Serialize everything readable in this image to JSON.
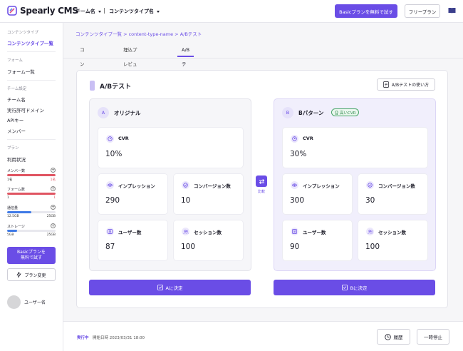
{
  "header": {
    "logo_text": "Spearly CMS",
    "team_select": "チーム名",
    "separator": "|",
    "content_type_select": "コンテンツタイプ名",
    "trial_button": "Basicプランを無料で試す",
    "plan_button": "フリープラン",
    "book_icon": "book-icon"
  },
  "sidebar": {
    "sections": {
      "content_type": "コンテンツタイプ",
      "form": "フォーム",
      "team": "チーム設定",
      "plan": "プラン"
    },
    "items": {
      "content_type_list": "コンテンツタイプ一覧",
      "form_list": "フォーム一覧",
      "team_name": "チーム名",
      "allowed_domains": "実行許可ドメイン",
      "api_key": "APIキー",
      "members": "メンバー",
      "usage": "利用状況"
    },
    "usage": [
      {
        "label": "メンバー数",
        "left": "1名",
        "right": "1名",
        "fill": 1.0,
        "color": "#e05562",
        "over": true
      },
      {
        "label": "フォーム数",
        "left": "1",
        "right": "1",
        "fill": 1.0,
        "color": "#e05562",
        "over": true
      },
      {
        "label": "通信量",
        "left": "12.5GB",
        "right": "25GB",
        "fill": 0.5,
        "color": "#3f7ae6",
        "over": false
      },
      {
        "label": "ストレージ",
        "left": "5GB",
        "right": "25GB",
        "fill": 0.2,
        "color": "#3f7ae6",
        "over": false
      }
    ],
    "trial_button_line1": "Basicプランを",
    "trial_button_line2": "無料で試す",
    "change_plan_button": "プラン変更",
    "user_name": "ユーザー名"
  },
  "breadcrumb": "コンテンツタイプ一覧 > content-type-name > A/Bテスト",
  "tabs": [
    {
      "label": "コンテンツ編集",
      "active": false
    },
    {
      "label": "埋込プレビュー(Beta)",
      "active": false
    },
    {
      "label": "A/Bテスト",
      "active": true
    }
  ],
  "ab": {
    "title": "A/Bテスト",
    "howto_button": "A/Bテストの使い方",
    "compare_label": "比較",
    "pattern_a": {
      "badge": "A",
      "name": "オリジナル",
      "cvr_label": "CVR",
      "cvr_value": "10%",
      "impressions_label": "インプレッション",
      "impressions_value": "290",
      "conversions_label": "コンバージョン数",
      "conversions_value": "10",
      "users_label": "ユーザー数",
      "users_value": "87",
      "sessions_label": "セッション数",
      "sessions_value": "100",
      "decide_button": "Aに決定"
    },
    "pattern_b": {
      "badge": "B",
      "name": "Bパターン",
      "tag": "高いCVR",
      "cvr_label": "CVR",
      "cvr_value": "30%",
      "impressions_label": "インプレッション",
      "impressions_value": "300",
      "conversions_label": "コンバージョン数",
      "conversions_value": "30",
      "users_label": "ユーザー数",
      "users_value": "90",
      "sessions_label": "セッション数",
      "sessions_value": "100",
      "decide_button": "Bに決定"
    }
  },
  "footer": {
    "status": "実行中",
    "start_date": "開始日時 2023/03/31 18:00",
    "history_button": "履歴",
    "pause_button": "一時停止"
  },
  "colors": {
    "accent": "#6a4de6",
    "danger": "#e05562",
    "info": "#3f7ae6",
    "success": "#2f8a4e"
  }
}
